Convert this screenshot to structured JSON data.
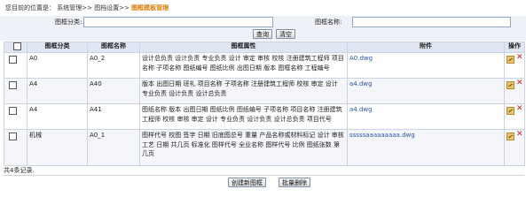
{
  "breadcrumb": {
    "prefix": "您目前的位置是：",
    "path": "系统管理>> 图档设置>> ",
    "current": "图框模板管理"
  },
  "search": {
    "category_label": "图框分类:",
    "category_value": "",
    "name_label": "图框名称:",
    "name_value": "",
    "query_button": "查询",
    "clear_button": "清空"
  },
  "table": {
    "headers": [
      "",
      "图框分类",
      "图框名称",
      "图框属性",
      "附件",
      "操作"
    ],
    "rows": [
      {
        "category": "A0",
        "name": "A0_2",
        "attributes": "设计总负责 设计负责 专业负责 设计 审定 审核 校核 注册建筑工程师 项目名称 子项名称 图纸编号 图纸比例 出图日期 版本 图框名称 工程编号",
        "attachment": "A0.dwg"
      },
      {
        "category": "A4",
        "name": "A40",
        "attributes": "版本 出图日期 班礼 项目名称 子项名称 注册建筑工程师 校核 审定 设计 专业负责 设计负责 设计总负责",
        "attachment": "a4.dwg"
      },
      {
        "category": "A4",
        "name": "A41",
        "attributes": "图纸名称 版本 出图日期 图纸比例 图纸编号 子项名称 项目名称 注册建筑工程师 校核 审核 审定 设计 专业负责 设计负责 设计总负责 项目代号",
        "attachment": "a4.dwg"
      },
      {
        "category": "机械",
        "name": "A0_1",
        "attributes": "图样代号 校图 签字 日期 旧底图总号 重量 产品名称或材料标记 设计 审核 工艺 日期 共几页 标准化 图样代号 全业名称 图样代号 比例 图纸张数 第几页",
        "attachment": "sssssaaaaaaaaa.dwg"
      }
    ]
  },
  "footer": {
    "record_count": "共4条记录.",
    "create_button": "创建新图框",
    "batch_delete_button": "批量删除"
  },
  "icons": {
    "edit": "edit-icon",
    "delete": "delete-icon"
  }
}
